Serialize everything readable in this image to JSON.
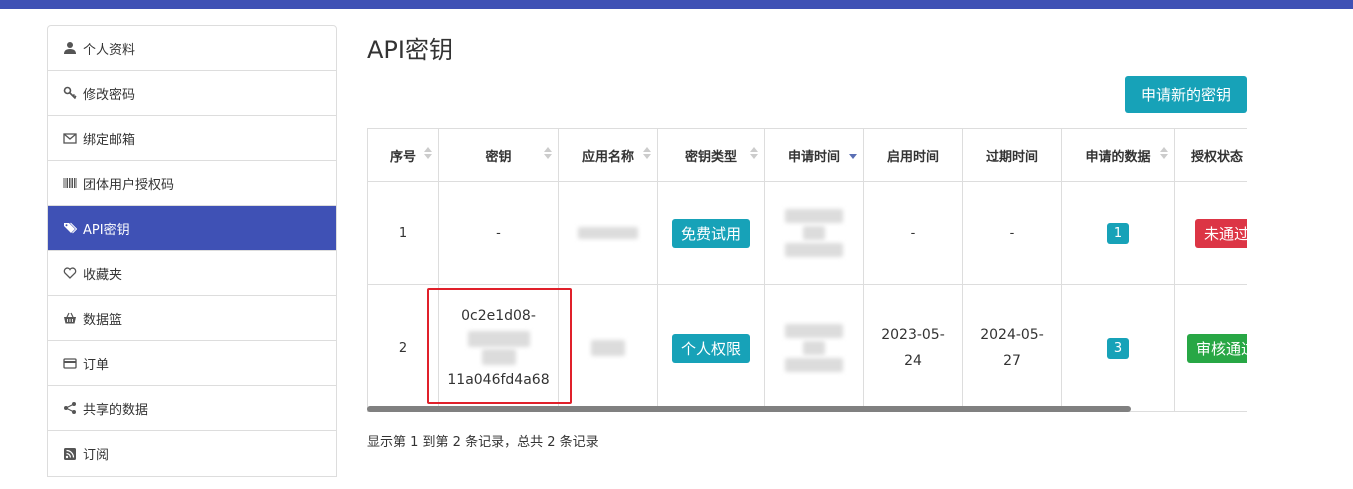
{
  "sidebar": {
    "items": [
      {
        "label": "个人资料",
        "icon": "user-icon"
      },
      {
        "label": "修改密码",
        "icon": "key-icon"
      },
      {
        "label": "绑定邮箱",
        "icon": "envelope-icon"
      },
      {
        "label": "团体用户授权码",
        "icon": "barcode-icon"
      },
      {
        "label": "API密钥",
        "icon": "tags-icon",
        "active": true
      },
      {
        "label": "收藏夹",
        "icon": "heart-icon"
      },
      {
        "label": "数据篮",
        "icon": "basket-icon"
      },
      {
        "label": "订单",
        "icon": "credit-card-icon"
      },
      {
        "label": "共享的数据",
        "icon": "share-icon"
      },
      {
        "label": "订阅",
        "icon": "rss-icon"
      }
    ]
  },
  "page": {
    "title": "API密钥",
    "new_key_button": "申请新的密钥"
  },
  "table": {
    "columns": [
      "序号",
      "密钥",
      "应用名称",
      "密钥类型",
      "申请时间",
      "启用时间",
      "过期时间",
      "申请的数据",
      "授权状态"
    ],
    "sorted_column": "申请时间",
    "rows": [
      {
        "index": "1",
        "key": "-",
        "app_name": "",
        "key_type": "免费试用",
        "apply_time": "",
        "enable_time": "-",
        "expire_time": "-",
        "data_count": "1",
        "status": "未通过"
      },
      {
        "index": "2",
        "key_line1": "0c2e1d08-",
        "key_line3": "11a046fd4a68",
        "app_name": "",
        "key_type": "个人权限",
        "apply_time": "",
        "enable_time_l1": "2023-05-",
        "enable_time_l2": "24",
        "expire_time_l1": "2024-05-",
        "expire_time_l2": "27",
        "data_count": "3",
        "status": "审核通过"
      }
    ]
  },
  "footer": {
    "summary": "显示第 1 到第 2 条记录，总共 2 条记录"
  },
  "colors": {
    "primary": "#3f51b5",
    "info": "#17a2b8",
    "danger": "#dc3545",
    "success": "#28a745",
    "highlight": "#e0202a"
  }
}
